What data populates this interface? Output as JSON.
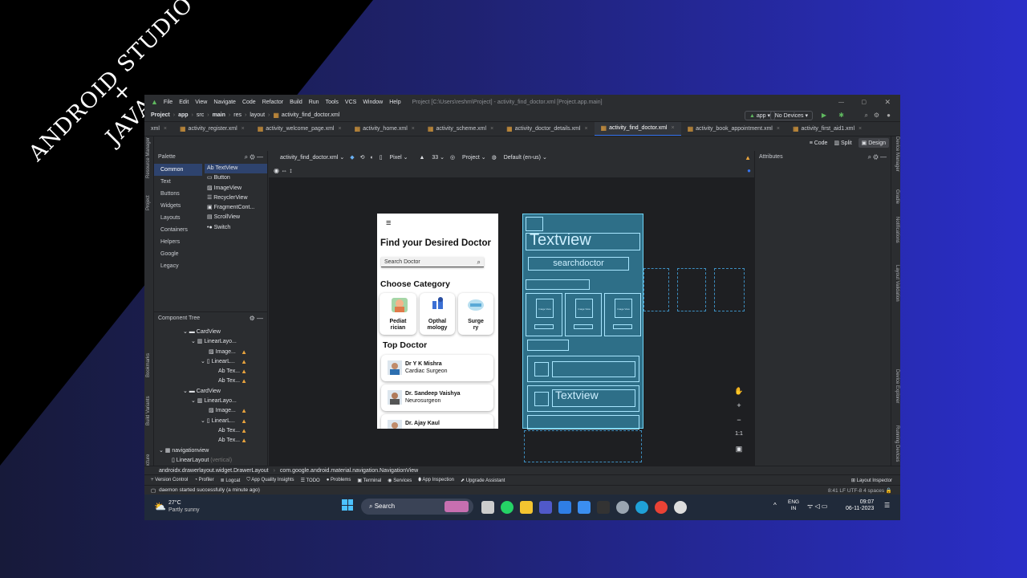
{
  "promo": {
    "line1": "ANDROID STUDIO",
    "line2": "+",
    "line3": "JAVA"
  },
  "menu": {
    "items": [
      "File",
      "Edit",
      "View",
      "Navigate",
      "Code",
      "Refactor",
      "Build",
      "Run",
      "Tools",
      "VCS",
      "Window",
      "Help"
    ],
    "title": "Project [C:\\Users\\reshm\\Project] - activity_find_doctor.xml [Project.app.main]"
  },
  "nav": {
    "crumbs": [
      "Project",
      "app",
      "src",
      "main",
      "res",
      "layout",
      "activity_find_doctor.xml"
    ],
    "run_config": "app",
    "device": "No Devices"
  },
  "tabs": [
    "xml",
    "activity_register.xml",
    "activity_welcome_page.xml",
    "activity_home.xml",
    "activity_scheme.xml",
    "activity_doctor_details.xml",
    "activity_find_doctor.xml",
    "activity_book_appointment.xml",
    "activity_first_aid1.xml"
  ],
  "view_modes": {
    "code": "Code",
    "split": "Split",
    "design": "Design"
  },
  "palette": {
    "title": "Palette",
    "categories": [
      "Common",
      "Text",
      "Buttons",
      "Widgets",
      "Layouts",
      "Containers",
      "Helpers",
      "Google",
      "Legacy"
    ],
    "items": [
      "Ab TextView",
      "Button",
      "ImageView",
      "RecyclerView",
      "FragmentCont...",
      "ScrollView",
      "Switch"
    ]
  },
  "component_tree": {
    "title": "Component Tree",
    "nodes": [
      "CardView",
      "LinearLayo...",
      "Image...",
      "LinearL...",
      "Ab Tex...",
      "Ab Tex...",
      "CardView",
      "LinearLayo...",
      "Image...",
      "LinearL...",
      "Ab Tex...",
      "Ab Tex...",
      "navigationview",
      "LinearLayout"
    ],
    "hint": "(vertical)"
  },
  "design_toolbar": {
    "file": "activity_find_doctor.xml",
    "device": "Pixel",
    "api": "33",
    "theme": "Project",
    "locale": "Default (en-us)"
  },
  "attributes": {
    "title": "Attributes"
  },
  "phone": {
    "title": "Find your Desired Doctor",
    "search_placeholder": "Search Doctor",
    "category_heading": "Choose Category",
    "categories": [
      {
        "l1": "Pediat",
        "l2": "rician"
      },
      {
        "l1": "Opthal",
        "l2": "mology"
      },
      {
        "l1": "Surge",
        "l2": "ry"
      }
    ],
    "top_heading": "Top Doctor",
    "doctors": [
      {
        "name": "Dr Y K Mishra",
        "spec": "Cardiac Surgeon"
      },
      {
        "name": "Dr. Sandeep Vaishya",
        "spec": "Neurosurgeon"
      },
      {
        "name": "Dr. Ajay Kaul",
        "spec": ""
      }
    ]
  },
  "blueprint": {
    "t1": "Textview",
    "t2": "searchdoctor",
    "t3": "Textview",
    "img": "Image View"
  },
  "zoom": {
    "fit": "1:1"
  },
  "status_path": [
    "androidx.drawerlayout.widget.DrawerLayout",
    "com.google.android.material.navigation.NavigationView"
  ],
  "toolwindows": [
    "Version Control",
    "Profiler",
    "Logcat",
    "App Quality Insights",
    "TODO",
    "Problems",
    "Terminal",
    "Services",
    "App Inspection",
    "Upgrade Assistant"
  ],
  "layout_inspector": "Layout Inspector",
  "notification": "daemon started successfully (a minute ago)",
  "caret": {
    "pos": "8:41",
    "le": "LF",
    "enc": "UTF-8",
    "indent": "4 spaces"
  },
  "side_left": [
    "Resource Manager",
    "Project",
    "Bookmarks",
    "Build Variants",
    "Structure"
  ],
  "side_right": [
    "Device Manager",
    "Gradle",
    "Notifications",
    "Layout Validation",
    "Device Explorer",
    "Running Devices"
  ],
  "weather": {
    "temp": "27°C",
    "desc": "Partly sunny"
  },
  "taskbar": {
    "search": "Search",
    "lang1": "ENG",
    "lang2": "IN",
    "time": "09:07",
    "date": "06-11-2023"
  },
  "colors": {
    "accent": "#3574f0",
    "bg_blue": "#2a2ec8",
    "blueprint": "#3cb0dc"
  }
}
